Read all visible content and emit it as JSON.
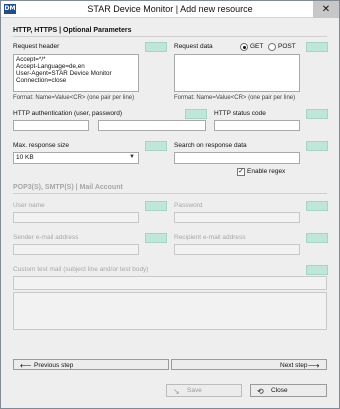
{
  "window": {
    "title": "STAR Device Monitor | Add new resource",
    "app_icon": "DM",
    "close_glyph": "✕"
  },
  "http_section": {
    "title": "HTTP, HTTPS | Optional Parameters"
  },
  "request_header": {
    "label": "Request header",
    "value": "Accept=*/*\nAccept-Language=de,en\nUser-Agent=STAR Device Monitor\nConnection=close",
    "hint": "Format: Name=Value<CR> (one pair per line)"
  },
  "request_data": {
    "label": "Request data",
    "get_label": "GET",
    "post_label": "POST",
    "selected": "GET",
    "hint": "Format: Name=Value<CR> (one pair per line)"
  },
  "http_auth": {
    "label": "HTTP authentication (user, password)",
    "user": "",
    "password": ""
  },
  "http_status": {
    "label": "HTTP status code",
    "value": ""
  },
  "max_response": {
    "label": "Max. response size",
    "value": "10 KB"
  },
  "search_response": {
    "label": "Search on response data",
    "value": "",
    "regex_label": "Enable regex",
    "regex_checked": true
  },
  "mail_section": {
    "title": "POP3(S), SMTP(S) | Mail Account"
  },
  "user_name": {
    "label": "User name"
  },
  "password": {
    "label": "Password"
  },
  "sender": {
    "label": "Sender e-mail address"
  },
  "recipient": {
    "label": "Recipient e-mail address"
  },
  "custom_mail": {
    "label": "Custom test mail (subject line and/or test body)"
  },
  "nav": {
    "prev": "Previous step",
    "next": "Next step",
    "prev_arrow": "⟵",
    "next_arrow": "⟶"
  },
  "actions": {
    "save": "Save",
    "close": "Close"
  },
  "colors": {
    "accent_field": "#bfe6d8",
    "window_bg": "#eeeeee"
  }
}
